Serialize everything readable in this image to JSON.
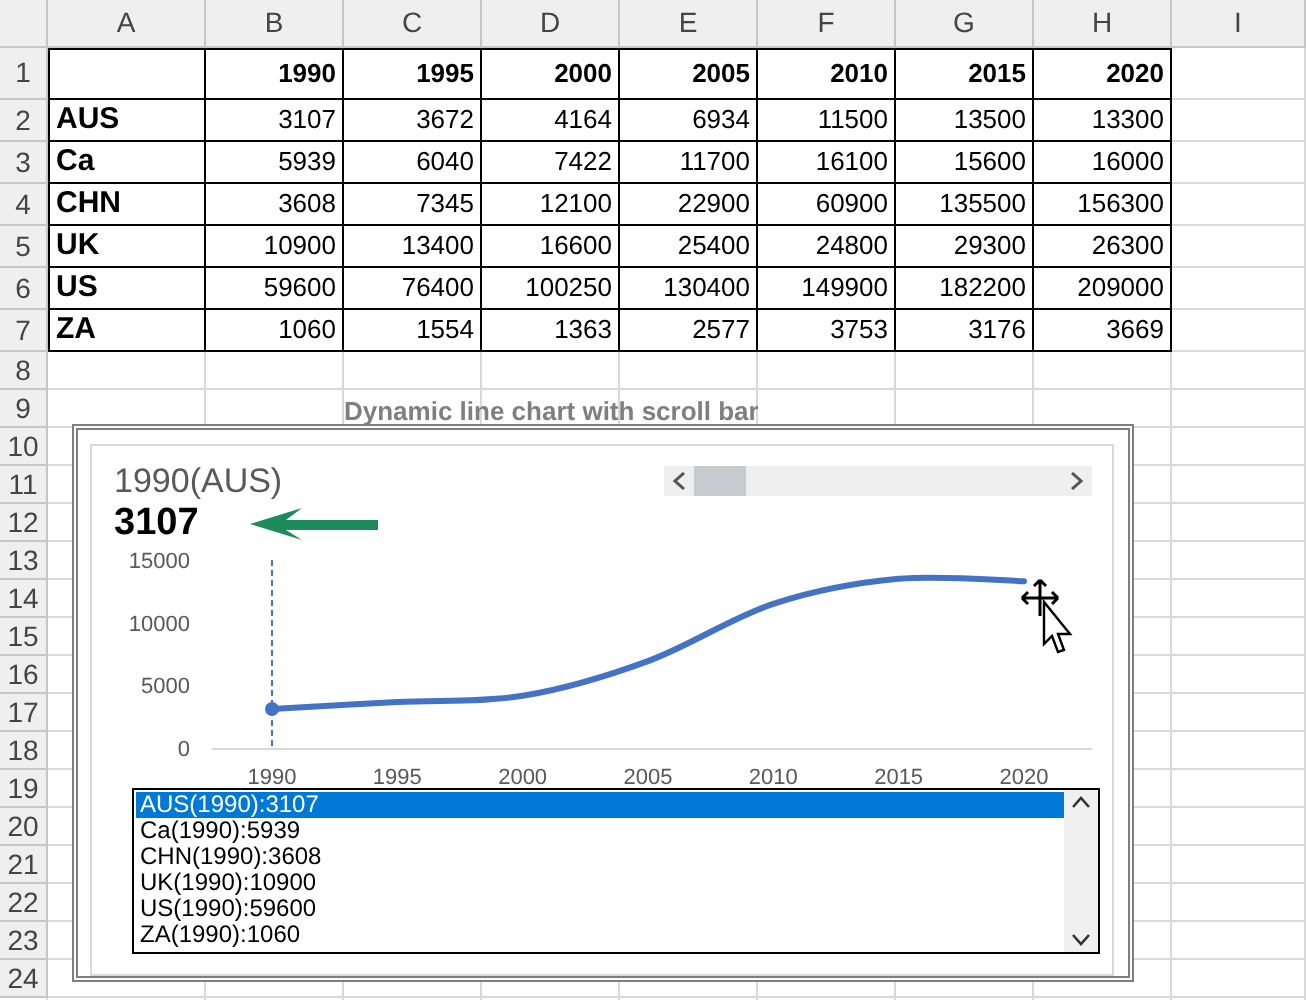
{
  "sheet": {
    "columns": [
      "A",
      "B",
      "C",
      "D",
      "E",
      "F",
      "G",
      "H",
      "I"
    ],
    "row_numbers": [
      "1",
      "2",
      "3",
      "4",
      "5",
      "6",
      "7",
      "8",
      "9",
      "10",
      "11",
      "12",
      "13",
      "14",
      "15",
      "16",
      "17",
      "18",
      "19",
      "20",
      "21",
      "22",
      "23",
      "24"
    ],
    "header_years": [
      "1990",
      "1995",
      "2000",
      "2005",
      "2010",
      "2015",
      "2020"
    ],
    "data": [
      {
        "label": "AUS",
        "values": [
          "3107",
          "3672",
          "4164",
          "6934",
          "11500",
          "13500",
          "13300"
        ]
      },
      {
        "label": "Ca",
        "values": [
          "5939",
          "6040",
          "7422",
          "11700",
          "16100",
          "15600",
          "16000"
        ]
      },
      {
        "label": "CHN",
        "values": [
          "3608",
          "7345",
          "12100",
          "22900",
          "60900",
          "135500",
          "156300"
        ]
      },
      {
        "label": "UK",
        "values": [
          "10900",
          "13400",
          "16600",
          "25400",
          "24800",
          "29300",
          "26300"
        ]
      },
      {
        "label": "US",
        "values": [
          "59600",
          "76400",
          "100250",
          "130400",
          "149900",
          "182200",
          "209000"
        ]
      },
      {
        "label": "ZA",
        "values": [
          "1060",
          "1554",
          "1363",
          "2577",
          "3753",
          "3176",
          "3669"
        ]
      }
    ]
  },
  "chart": {
    "caption": "Dynamic line chart with scroll bar",
    "point_label": "1990(AUS)",
    "point_value": "3107",
    "chart_data": {
      "type": "line",
      "categories": [
        "1990",
        "1995",
        "2000",
        "2005",
        "2010",
        "2015",
        "2020"
      ],
      "series": [
        {
          "color": "#4472c4",
          "values": [
            3107,
            3672,
            4164,
            6934,
            11500,
            13500,
            13300
          ]
        }
      ],
      "ref_lines": [
        {
          "axis": "x",
          "value": "1990",
          "color": "#4472c4"
        }
      ],
      "yticks": [
        0,
        5000,
        10000,
        15000
      ],
      "ylim": [
        0,
        15000
      ]
    },
    "list": [
      {
        "text": "AUS(1990):3107",
        "selected": true
      },
      {
        "text": "Ca(1990):5939",
        "selected": false
      },
      {
        "text": "CHN(1990):3608",
        "selected": false
      },
      {
        "text": "UK(1990):10900",
        "selected": false
      },
      {
        "text": "US(1990):59600",
        "selected": false
      },
      {
        "text": "ZA(1990):1060",
        "selected": false
      }
    ]
  }
}
